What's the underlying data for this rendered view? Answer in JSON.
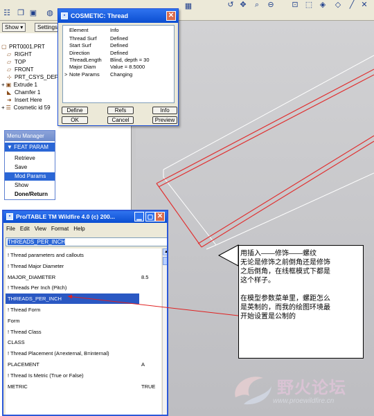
{
  "cosmetic_dialog": {
    "title": "COSMETIC: Thread",
    "col_element": "Element",
    "col_info": "Info",
    "rows": [
      {
        "element": "Thread Surf",
        "info": "Defined"
      },
      {
        "element": "Start Surf",
        "info": "Defined"
      },
      {
        "element": "Direction",
        "info": "Defined"
      },
      {
        "element": "ThreadLength",
        "info": "Blind, depth = 30"
      },
      {
        "element": "Major Diam",
        "info": "Value = 8.5000"
      },
      {
        "element": "Note Params",
        "info": "Changing",
        "arrow": ">"
      }
    ],
    "buttons": {
      "define": "Define",
      "refs": "Refs",
      "info": "Info",
      "ok": "OK",
      "cancel": "Cancel",
      "preview": "Preview"
    }
  },
  "model_tree": {
    "show_label": "Show ▾",
    "settings_label": "Settings",
    "items": [
      {
        "label": "PRT0001.PRT",
        "icon": "▢"
      },
      {
        "label": "RIGHT",
        "icon": "▱"
      },
      {
        "label": "TOP",
        "icon": "▱"
      },
      {
        "label": "FRONT",
        "icon": "▱"
      },
      {
        "label": "PRT_CSYS_DEF",
        "icon": "⊹"
      },
      {
        "label": "Extrude 1",
        "icon": "▣",
        "expander": "+"
      },
      {
        "label": "Chamfer 1",
        "icon": "◣"
      },
      {
        "label": "Insert Here",
        "icon": "➜"
      },
      {
        "label": "Cosmetic id 59",
        "icon": "☰",
        "expander": "+"
      }
    ]
  },
  "menu_manager": {
    "title": "Menu Manager",
    "header": "▼ FEAT PARAM",
    "items": [
      "Retrieve",
      "Save",
      "Mod Params",
      "Show",
      "Done/Return"
    ]
  },
  "protable": {
    "title": "Pro/TABLE  TM  Wildfire 4.0  (c) 200...",
    "menu": [
      "File",
      "Edit",
      "View",
      "Format",
      "Help"
    ],
    "edit_value": "THREADS_PER_INCH",
    "rows": [
      {
        "name": "! Thread parameters and callouts",
        "value": ""
      },
      {
        "name": "! Thread Major Diameter",
        "value": ""
      },
      {
        "name": "MAJOR_DIAMETER",
        "value": "8.5"
      },
      {
        "name": "! Threads Per Inch (Pitch)",
        "value": ""
      },
      {
        "name": "THREADS_PER_INCH",
        "value": "",
        "selected": true
      },
      {
        "name": "! Thread Form",
        "value": ""
      },
      {
        "name": "Form",
        "value": ""
      },
      {
        "name": "! Thread Class",
        "value": ""
      },
      {
        "name": "CLASS",
        "value": ""
      },
      {
        "name": "! Thread Placement (A=external, B=internal)",
        "value": ""
      },
      {
        "name": "PLACEMENT",
        "value": "A"
      },
      {
        "name": "! Thread Is Metric (True or False)",
        "value": ""
      },
      {
        "name": "METRIC",
        "value": "TRUE"
      }
    ]
  },
  "note": {
    "lines": [
      "用插入——修饰——螺纹",
      "无论是修饰之前倒角还是修饰",
      "之后倒角，在线框模式下都是",
      "这个样子。",
      "",
      "在模型参数菜单里，螺距怎么",
      "是英制的，而我的绘图环境最",
      "开始设置是公制的"
    ]
  },
  "watermark": {
    "brand": "野火论坛",
    "url": "www.proewildfire.cn"
  },
  "colors": {
    "titlebar": "#0b4ed1",
    "selection": "#2a58c3",
    "arrow": "#e02020"
  }
}
